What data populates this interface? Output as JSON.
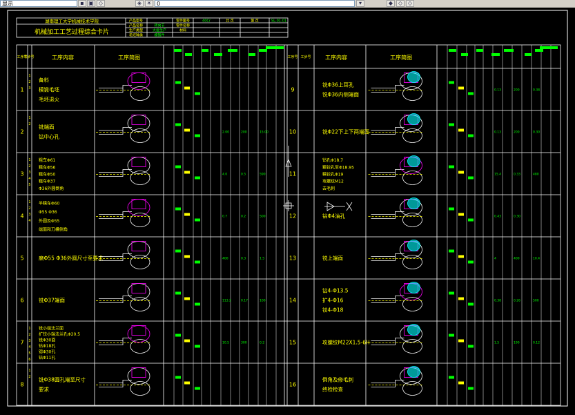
{
  "toolbar": {
    "combo_left_value": "显示",
    "combo_mid_value": "0",
    "icons": [
      "save-icon",
      "print-icon",
      "layer-icon",
      "layer-state-icon",
      "sun-icon",
      "lightbulb-icon",
      "layer-color-icon",
      "layers-stack-icon",
      "layer-prev-icon"
    ]
  },
  "drawing": {
    "header": {
      "school_name": "湖南理工大学机械技术学院",
      "card_title": "机械加工工艺过程综合卡片",
      "product_model_label": "产品型号",
      "product_name_label": "产品名称",
      "part_drawing_label": "零件图号",
      "part_name_label": "零件名称",
      "part_name_value": "转向节",
      "material_label": "材料",
      "material_value": "40Cr",
      "page_label": "共 页",
      "sheet_label": "第 页",
      "code_value": "SL-01-01",
      "production_label": "生产类型",
      "production_value": "大批生产",
      "blank_label": "毛坯种类",
      "blank_value": "模锻件"
    },
    "left_cols": {
      "seq": "工序号",
      "step": "工步号",
      "content": "工序内容",
      "sketch": "工序简图"
    },
    "right_cols": {
      "seq": "工序号",
      "step": "工步号",
      "content": "工序内容",
      "sketch": "工序简图"
    },
    "left_ops": [
      {
        "no": "1",
        "steps": [
          "1",
          "2",
          "3"
        ],
        "lines": [
          "备料",
          "模锻毛坯",
          "毛坯退火"
        ],
        "params": [
          "",
          "",
          ""
        ]
      },
      {
        "no": "2",
        "steps": [
          "1",
          "2"
        ],
        "lines": [
          "铣端面",
          "钻中心孔"
        ],
        "params": [
          "2.00",
          "200",
          "15.00"
        ]
      },
      {
        "no": "3",
        "steps": [
          "1",
          "2",
          "3",
          "4",
          "5"
        ],
        "lines": [
          "粗车Φ61",
          "粗车Φ56",
          "粗车Φ50",
          "粗车Φ37",
          "Φ36外圆倒角"
        ],
        "params": [
          "4.0",
          "0.5",
          "590"
        ]
      },
      {
        "no": "4",
        "steps": [
          "1",
          "2",
          "3",
          "4"
        ],
        "lines": [
          "半精车Φ60",
          "Φ55 Φ36",
          "外圆及Φ55",
          "端面和刀槽倒角"
        ],
        "params": [
          "0.7",
          "0.2",
          "500"
        ]
      },
      {
        "no": "5",
        "steps": [],
        "lines": [
          "磨Φ55 Φ36外圆尺寸至要求"
        ],
        "params": [
          "400",
          "0.3",
          "1.5"
        ]
      },
      {
        "no": "6",
        "steps": [],
        "lines": [
          "铣Φ37端面"
        ],
        "params": [
          "113.2",
          "0.17",
          "100"
        ]
      },
      {
        "no": "7",
        "steps": [
          "1",
          "2",
          "3",
          "4",
          "5",
          "6"
        ],
        "lines": [
          "铣小端法兰面",
          "扩铰小端法兰孔Φ20.5",
          "铣Φ30面",
          "钻Φ18孔",
          "锪Φ30孔",
          "钻Φ11孔"
        ],
        "params": [
          "10.5",
          "300",
          "0.2"
        ]
      },
      {
        "no": "8",
        "steps": [
          "1",
          "2"
        ],
        "lines": [
          "铣Φ38圆孔端至尺寸",
          "要求"
        ],
        "params": [
          "",
          "",
          ""
        ]
      }
    ],
    "right_ops": [
      {
        "no": "9",
        "steps": [],
        "lines": [
          "铣Φ36上耳孔",
          "铣Φ36内侧端面"
        ],
        "params": [
          "0.13",
          "200",
          "0.38"
        ]
      },
      {
        "no": "10",
        "steps": [],
        "lines": [
          "铣Φ22下上下两端面"
        ],
        "params": [
          "0.13",
          "200",
          "0.30"
        ]
      },
      {
        "no": "11",
        "steps": [],
        "lines": [
          "钻孔Φ18.7",
          "粗铰孔至Φ18.95",
          "精铰孔Φ19",
          "攻螺纹M12",
          "去毛刺"
        ],
        "params": [
          "15.4",
          "0.33",
          "480"
        ]
      },
      {
        "no": "12",
        "steps": [],
        "lines": [
          "钻Φ4油孔"
        ],
        "params": [
          "0.43",
          "0.30",
          ""
        ]
      },
      {
        "no": "13",
        "steps": [],
        "lines": [
          "铣上端面"
        ],
        "params": [
          "4",
          "400",
          "10.4"
        ]
      },
      {
        "no": "14",
        "steps": [],
        "lines": [
          "钻4-Φ13.5",
          "扩4-Φ16",
          "铰4-Φ18"
        ],
        "params": [
          "0.38",
          "0.26",
          "500"
        ]
      },
      {
        "no": "15",
        "steps": [],
        "lines": [
          "攻螺纹M22X1.5-6H"
        ],
        "params": [
          "1.5",
          "190",
          "0.12"
        ]
      },
      {
        "no": "16",
        "steps": [],
        "lines": [
          "倒角及修毛刺",
          "终检检查"
        ],
        "params": [
          "",
          "",
          ""
        ]
      }
    ],
    "colors": {
      "frame": "#ffffff",
      "text_yellow": "#ffff00",
      "text_green": "#00ff00",
      "geometry_magenta": "#ff00ff",
      "geometry_cyan": "#00ffff",
      "background": "#000000"
    }
  }
}
